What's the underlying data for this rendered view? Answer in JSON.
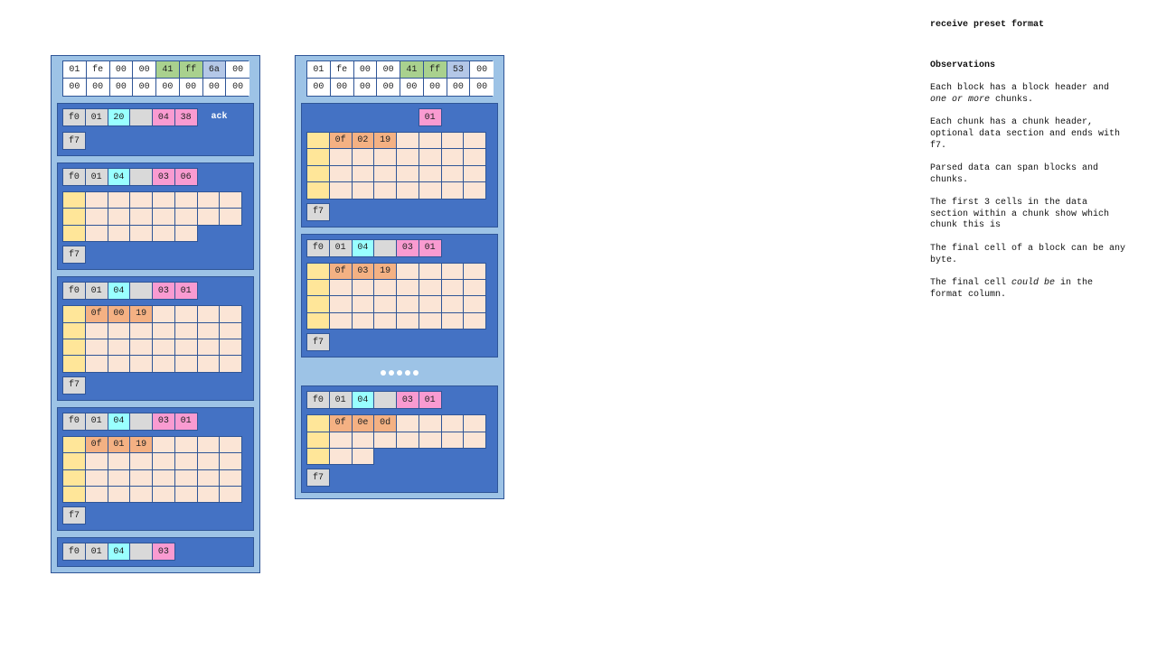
{
  "colors": {
    "white": "#ffffff",
    "grey": "#d9d9d9",
    "cyan": "#99ffff",
    "pink": "#f99bd1",
    "green": "#a9d18e",
    "lavender": "#b4c7e7",
    "yellow": "#ffe699",
    "peach": "#fbe5d6",
    "orange": "#f4b183"
  },
  "blocks": [
    {
      "header": [
        [
          {
            "v": "01",
            "c": "white"
          },
          {
            "v": "fe",
            "c": "white"
          },
          {
            "v": "00",
            "c": "white"
          },
          {
            "v": "00",
            "c": "white"
          },
          {
            "v": "41",
            "c": "green"
          },
          {
            "v": "ff",
            "c": "green"
          },
          {
            "v": "6a",
            "c": "lavender"
          },
          {
            "v": "00",
            "c": "white"
          }
        ],
        [
          {
            "v": "00",
            "c": "white"
          },
          {
            "v": "00",
            "c": "white"
          },
          {
            "v": "00",
            "c": "white"
          },
          {
            "v": "00",
            "c": "white"
          },
          {
            "v": "00",
            "c": "white"
          },
          {
            "v": "00",
            "c": "white"
          },
          {
            "v": "00",
            "c": "white"
          },
          {
            "v": "00",
            "c": "white"
          }
        ]
      ],
      "chunks": [
        {
          "head": [
            {
              "v": "f0",
              "c": "grey"
            },
            {
              "v": "01",
              "c": "grey"
            },
            {
              "v": "20",
              "c": "cyan"
            },
            {
              "v": "",
              "c": "grey"
            },
            {
              "v": "04",
              "c": "pink"
            },
            {
              "v": "38",
              "c": "pink"
            }
          ],
          "label": "ack",
          "rows": [],
          "end": "f7"
        },
        {
          "head": [
            {
              "v": "f0",
              "c": "grey"
            },
            {
              "v": "01",
              "c": "grey"
            },
            {
              "v": "04",
              "c": "cyan"
            },
            {
              "v": "",
              "c": "grey"
            },
            {
              "v": "03",
              "c": "pink"
            },
            {
              "v": "06",
              "c": "pink"
            }
          ],
          "rows": [
            {
              "len": 8,
              "vals": []
            },
            {
              "len": 8,
              "vals": []
            },
            {
              "len": 6,
              "vals": []
            }
          ],
          "end": "f7"
        },
        {
          "head": [
            {
              "v": "f0",
              "c": "grey"
            },
            {
              "v": "01",
              "c": "grey"
            },
            {
              "v": "04",
              "c": "cyan"
            },
            {
              "v": "",
              "c": "grey"
            },
            {
              "v": "03",
              "c": "pink"
            },
            {
              "v": "01",
              "c": "pink"
            }
          ],
          "rows": [
            {
              "len": 8,
              "vals": [
                "0f",
                "00",
                "19"
              ]
            },
            {
              "len": 8,
              "vals": []
            },
            {
              "len": 8,
              "vals": []
            },
            {
              "len": 8,
              "vals": []
            }
          ],
          "end": "f7"
        },
        {
          "head": [
            {
              "v": "f0",
              "c": "grey"
            },
            {
              "v": "01",
              "c": "grey"
            },
            {
              "v": "04",
              "c": "cyan"
            },
            {
              "v": "",
              "c": "grey"
            },
            {
              "v": "03",
              "c": "pink"
            },
            {
              "v": "01",
              "c": "pink"
            }
          ],
          "rows": [
            {
              "len": 8,
              "vals": [
                "0f",
                "01",
                "19"
              ]
            },
            {
              "len": 8,
              "vals": []
            },
            {
              "len": 8,
              "vals": []
            },
            {
              "len": 8,
              "vals": []
            }
          ],
          "end": "f7"
        },
        {
          "head": [
            {
              "v": "f0",
              "c": "grey"
            },
            {
              "v": "01",
              "c": "grey"
            },
            {
              "v": "04",
              "c": "cyan"
            },
            {
              "v": "",
              "c": "grey"
            },
            {
              "v": "03",
              "c": "pink"
            }
          ],
          "rows": []
        }
      ]
    },
    {
      "header": [
        [
          {
            "v": "01",
            "c": "white"
          },
          {
            "v": "fe",
            "c": "white"
          },
          {
            "v": "00",
            "c": "white"
          },
          {
            "v": "00",
            "c": "white"
          },
          {
            "v": "41",
            "c": "green"
          },
          {
            "v": "ff",
            "c": "green"
          },
          {
            "v": "53",
            "c": "lavender"
          },
          {
            "v": "00",
            "c": "white"
          }
        ],
        [
          {
            "v": "00",
            "c": "white"
          },
          {
            "v": "00",
            "c": "white"
          },
          {
            "v": "00",
            "c": "white"
          },
          {
            "v": "00",
            "c": "white"
          },
          {
            "v": "00",
            "c": "white"
          },
          {
            "v": "00",
            "c": "white"
          },
          {
            "v": "00",
            "c": "white"
          },
          {
            "v": "00",
            "c": "white"
          }
        ]
      ],
      "chunks": [
        {
          "head": [
            null,
            null,
            null,
            null,
            null,
            {
              "v": "01",
              "c": "pink"
            }
          ],
          "rows": [
            {
              "len": 8,
              "vals": [
                "0f",
                "02",
                "19"
              ]
            },
            {
              "len": 8,
              "vals": []
            },
            {
              "len": 8,
              "vals": []
            },
            {
              "len": 8,
              "vals": []
            }
          ],
          "end": "f7"
        },
        {
          "head": [
            {
              "v": "f0",
              "c": "grey"
            },
            {
              "v": "01",
              "c": "grey"
            },
            {
              "v": "04",
              "c": "cyan"
            },
            {
              "v": "",
              "c": "grey"
            },
            {
              "v": "03",
              "c": "pink"
            },
            {
              "v": "01",
              "c": "pink"
            }
          ],
          "rows": [
            {
              "len": 8,
              "vals": [
                "0f",
                "03",
                "19"
              ]
            },
            {
              "len": 8,
              "vals": []
            },
            {
              "len": 8,
              "vals": []
            },
            {
              "len": 8,
              "vals": []
            }
          ],
          "end": "f7"
        },
        {
          "ellipsis": true
        },
        {
          "head": [
            {
              "v": "f0",
              "c": "grey"
            },
            {
              "v": "01",
              "c": "grey"
            },
            {
              "v": "04",
              "c": "cyan"
            },
            {
              "v": "",
              "c": "grey"
            },
            {
              "v": "03",
              "c": "pink"
            },
            {
              "v": "01",
              "c": "pink"
            }
          ],
          "rows": [
            {
              "len": 8,
              "vals": [
                "0f",
                "0e",
                "0d"
              ]
            },
            {
              "len": 8,
              "vals": []
            },
            {
              "len": 3,
              "vals": []
            }
          ],
          "end": "f7"
        }
      ]
    }
  ],
  "notes": {
    "title": "receive preset format",
    "heading": "Observations",
    "p1a": "Each block has a block header and ",
    "p1em": "one or more",
    "p1b": " chunks.",
    "p2": "Each chunk has a chunk header, optional data section and ends with f7.",
    "p3": "Parsed data can span blocks and chunks.",
    "p4": "The first 3 cells in the data section within a chunk show which chunk this is",
    "p5": "The final cell of a block can be any byte.",
    "p6a": "The final cell ",
    "p6em": "could be",
    "p6b": " in the format column."
  }
}
